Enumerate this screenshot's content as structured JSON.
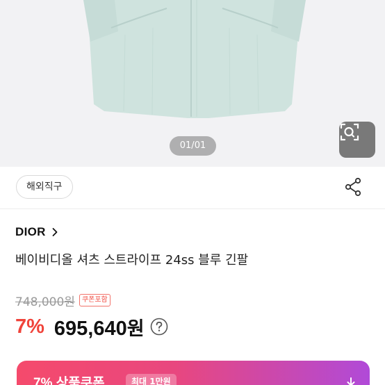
{
  "gallery": {
    "counter": "01/01",
    "image_alt": "light blue striped shirt",
    "lens_icon": "image-search-icon"
  },
  "badges": {
    "overseas_direct": "해외직구"
  },
  "actions": {
    "share_icon": "share-icon"
  },
  "product": {
    "brand": "DIOR",
    "brand_chevron_icon": "chevron-right-icon",
    "title": "베이비디올 셔츠 스트라이프 24ss 블루 긴팔"
  },
  "pricing": {
    "original_price": "748,000원",
    "coupon_included": "쿠폰포함",
    "discount_rate": "7%",
    "final_price": "695,640",
    "currency_unit": "원",
    "help_icon": "question-circle-icon"
  },
  "coupon_banner": {
    "title": "7% 상품쿠폰",
    "badge": "최대 1만원",
    "arrow_icon": "download-icon"
  },
  "colors": {
    "accent_red": "#f0433a",
    "banner_start": "#f54a6c",
    "banner_end": "#b04ad8"
  }
}
